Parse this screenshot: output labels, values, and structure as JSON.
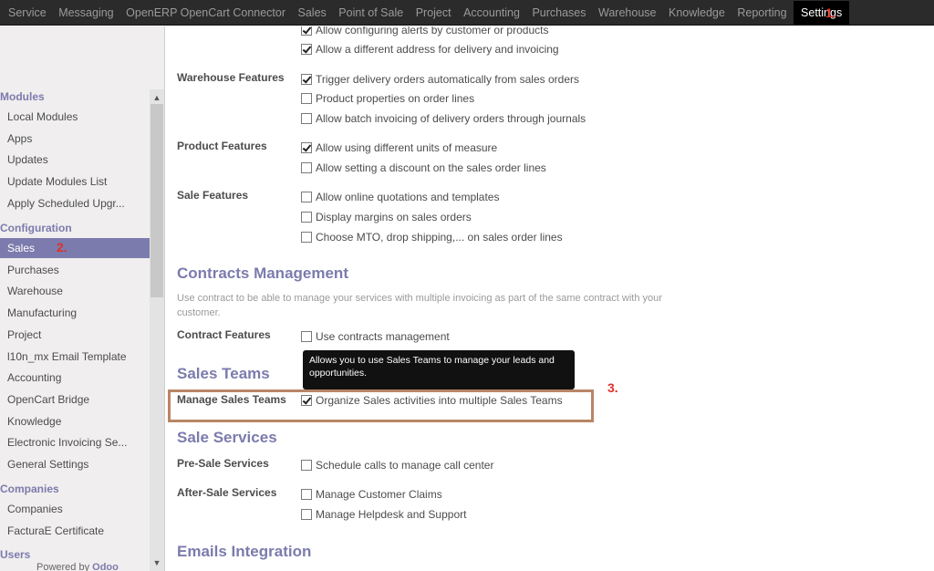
{
  "topbar": {
    "menu": [
      "Service",
      "Messaging",
      "OpenERP OpenCart Connector",
      "Sales",
      "Point of Sale",
      "Project",
      "Accounting",
      "Purchases",
      "Warehouse",
      "Knowledge",
      "Reporting",
      "Settings"
    ],
    "active": "Settings",
    "marker": "1."
  },
  "sidebar": {
    "modules_head": "Modules",
    "modules": [
      "Local Modules",
      "Apps",
      "Updates",
      "Update Modules List",
      "Apply Scheduled Upgr..."
    ],
    "configuration_head": "Configuration",
    "configuration": [
      "Sales",
      "Purchases",
      "Warehouse",
      "Manufacturing",
      "Project",
      "l10n_mx Email Template",
      "Accounting",
      "OpenCart Bridge",
      "Knowledge",
      "Electronic Invoicing Se...",
      "General Settings"
    ],
    "companies_head": "Companies",
    "companies": [
      "Companies",
      "FacturaE Certificate"
    ],
    "users_head": "Users",
    "active": "Sales",
    "marker": "2.",
    "powered_prefix": "Powered by",
    "powered_brand": "Odoo"
  },
  "main": {
    "top_options": [
      {
        "label": "Allow configuring alerts by customer or products",
        "checked": true
      },
      {
        "label": "Allow a different address for delivery and invoicing",
        "checked": true
      }
    ],
    "warehouse_label": "Warehouse Features",
    "warehouse_options": [
      {
        "label": "Trigger delivery orders automatically from sales orders",
        "checked": true
      },
      {
        "label": "Product properties on order lines",
        "checked": false
      },
      {
        "label": "Allow batch invoicing of delivery orders through journals",
        "checked": false
      }
    ],
    "product_label": "Product Features",
    "product_options": [
      {
        "label": "Allow using different units of measure",
        "checked": true
      },
      {
        "label": "Allow setting a discount on the sales order lines",
        "checked": false
      }
    ],
    "sale_label": "Sale Features",
    "sale_options": [
      {
        "label": "Allow online quotations and templates",
        "checked": false
      },
      {
        "label": "Display margins on sales orders",
        "checked": false
      },
      {
        "label": "Choose MTO, drop shipping,... on sales order lines",
        "checked": false
      }
    ],
    "contracts_title": "Contracts Management",
    "contracts_desc": "Use contract to be able to manage your services with multiple invoicing as part of the same contract with your customer.",
    "contract_label": "Contract Features",
    "contract_options": [
      {
        "label": "Use contracts management",
        "checked": false
      }
    ],
    "teams_title": "Sales Teams",
    "tooltip": "Allows you to use Sales Teams to manage your leads and opportunities.",
    "teams_label": "Manage Sales Teams",
    "teams_options": [
      {
        "label": "Organize Sales activities into multiple Sales Teams",
        "checked": true
      }
    ],
    "marker": "3.",
    "services_title": "Sale Services",
    "presale_label": "Pre-Sale Services",
    "presale_options": [
      {
        "label": "Schedule calls to manage call center",
        "checked": false
      }
    ],
    "aftersale_label": "After-Sale Services",
    "aftersale_options": [
      {
        "label": "Manage Customer Claims",
        "checked": false
      },
      {
        "label": "Manage Helpdesk and Support",
        "checked": false
      }
    ],
    "emails_title": "Emails Integration"
  }
}
